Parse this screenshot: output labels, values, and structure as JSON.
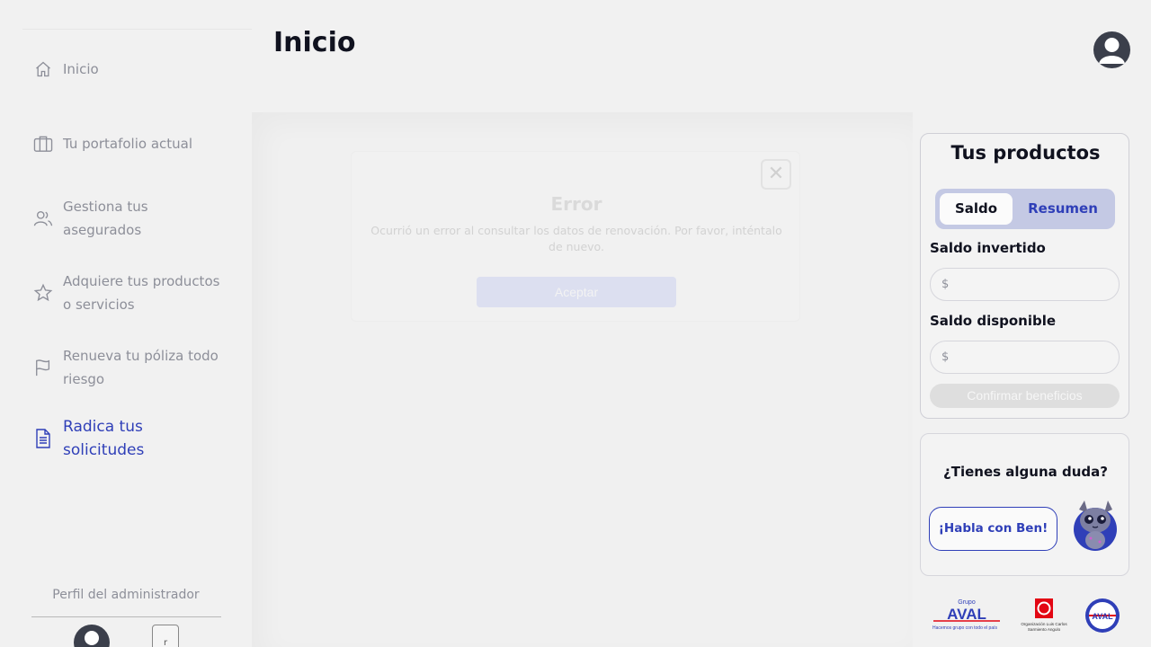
{
  "header": {
    "title": "Inicio"
  },
  "sidebar": {
    "items": [
      {
        "label": "Inicio",
        "icon": "home-icon"
      },
      {
        "label": "Tu portafolio actual",
        "icon": "briefcase-icon"
      },
      {
        "label": "Gestiona tus asegurados",
        "icon": "users-icon"
      },
      {
        "label": "Adquiere tus productos o servicios",
        "icon": "star-icon"
      },
      {
        "label": "Renueva tu póliza todo riesgo",
        "icon": "flag-icon"
      },
      {
        "label": "Radica tus solicitudes",
        "icon": "document-icon",
        "active": true
      }
    ],
    "admin_title": "Perfil del administrador",
    "admin_button": "r"
  },
  "modal": {
    "title": "Error",
    "message": "Ocurrió un error al consultar los datos de renovación. Por favor, inténtalo de nuevo.",
    "accept_label": "Aceptar",
    "close_glyph": "✕"
  },
  "products": {
    "title": "Tus productos",
    "tabs": {
      "saldo": "Saldo",
      "resumen": "Resumen"
    },
    "saldo_invertido_label": "Saldo invertido",
    "saldo_invertido_value": "$",
    "saldo_disponible_label": "Saldo disponible",
    "saldo_disponible_value": "$",
    "confirm_label": "Confirmar beneficios"
  },
  "help": {
    "title": "¿Tienes alguna duda?",
    "button_label": "¡Habla con Ben!"
  },
  "logos": {
    "aval_top": "Grupo",
    "aval_name": "AVAL",
    "aval_tagline": "Hacemos grupo con todo el país",
    "sarmiento_line1": "Organización Luis Carlos",
    "sarmiento_line2": "Sarmiento Angulo"
  },
  "colors": {
    "accent": "#2f3fb8",
    "toggle_bg": "#c4c9e4",
    "text_muted": "#8d8f99",
    "aval_red": "#e30613"
  }
}
